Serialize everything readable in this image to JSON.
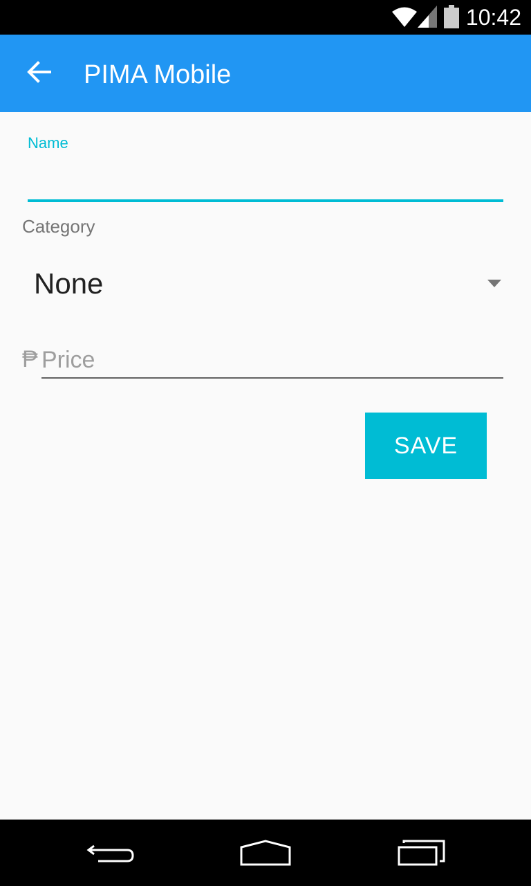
{
  "status_bar": {
    "time": "10:42",
    "icons": [
      "wifi-icon",
      "signal-icon",
      "battery-icon"
    ]
  },
  "app_bar": {
    "title": "PIMA Mobile",
    "back_icon": "arrow-back-icon",
    "color": "#2196f3"
  },
  "form": {
    "name_label": "Name",
    "name_value": "",
    "category_label": "Category",
    "category_selected": "None",
    "currency_symbol": "₱",
    "price_placeholder": "Price",
    "price_value": "",
    "save_label": "SAVE",
    "accent_color": "#00bcd4"
  },
  "nav_bar": {
    "icons": [
      "nav-back-icon",
      "nav-home-icon",
      "nav-recents-icon"
    ]
  }
}
